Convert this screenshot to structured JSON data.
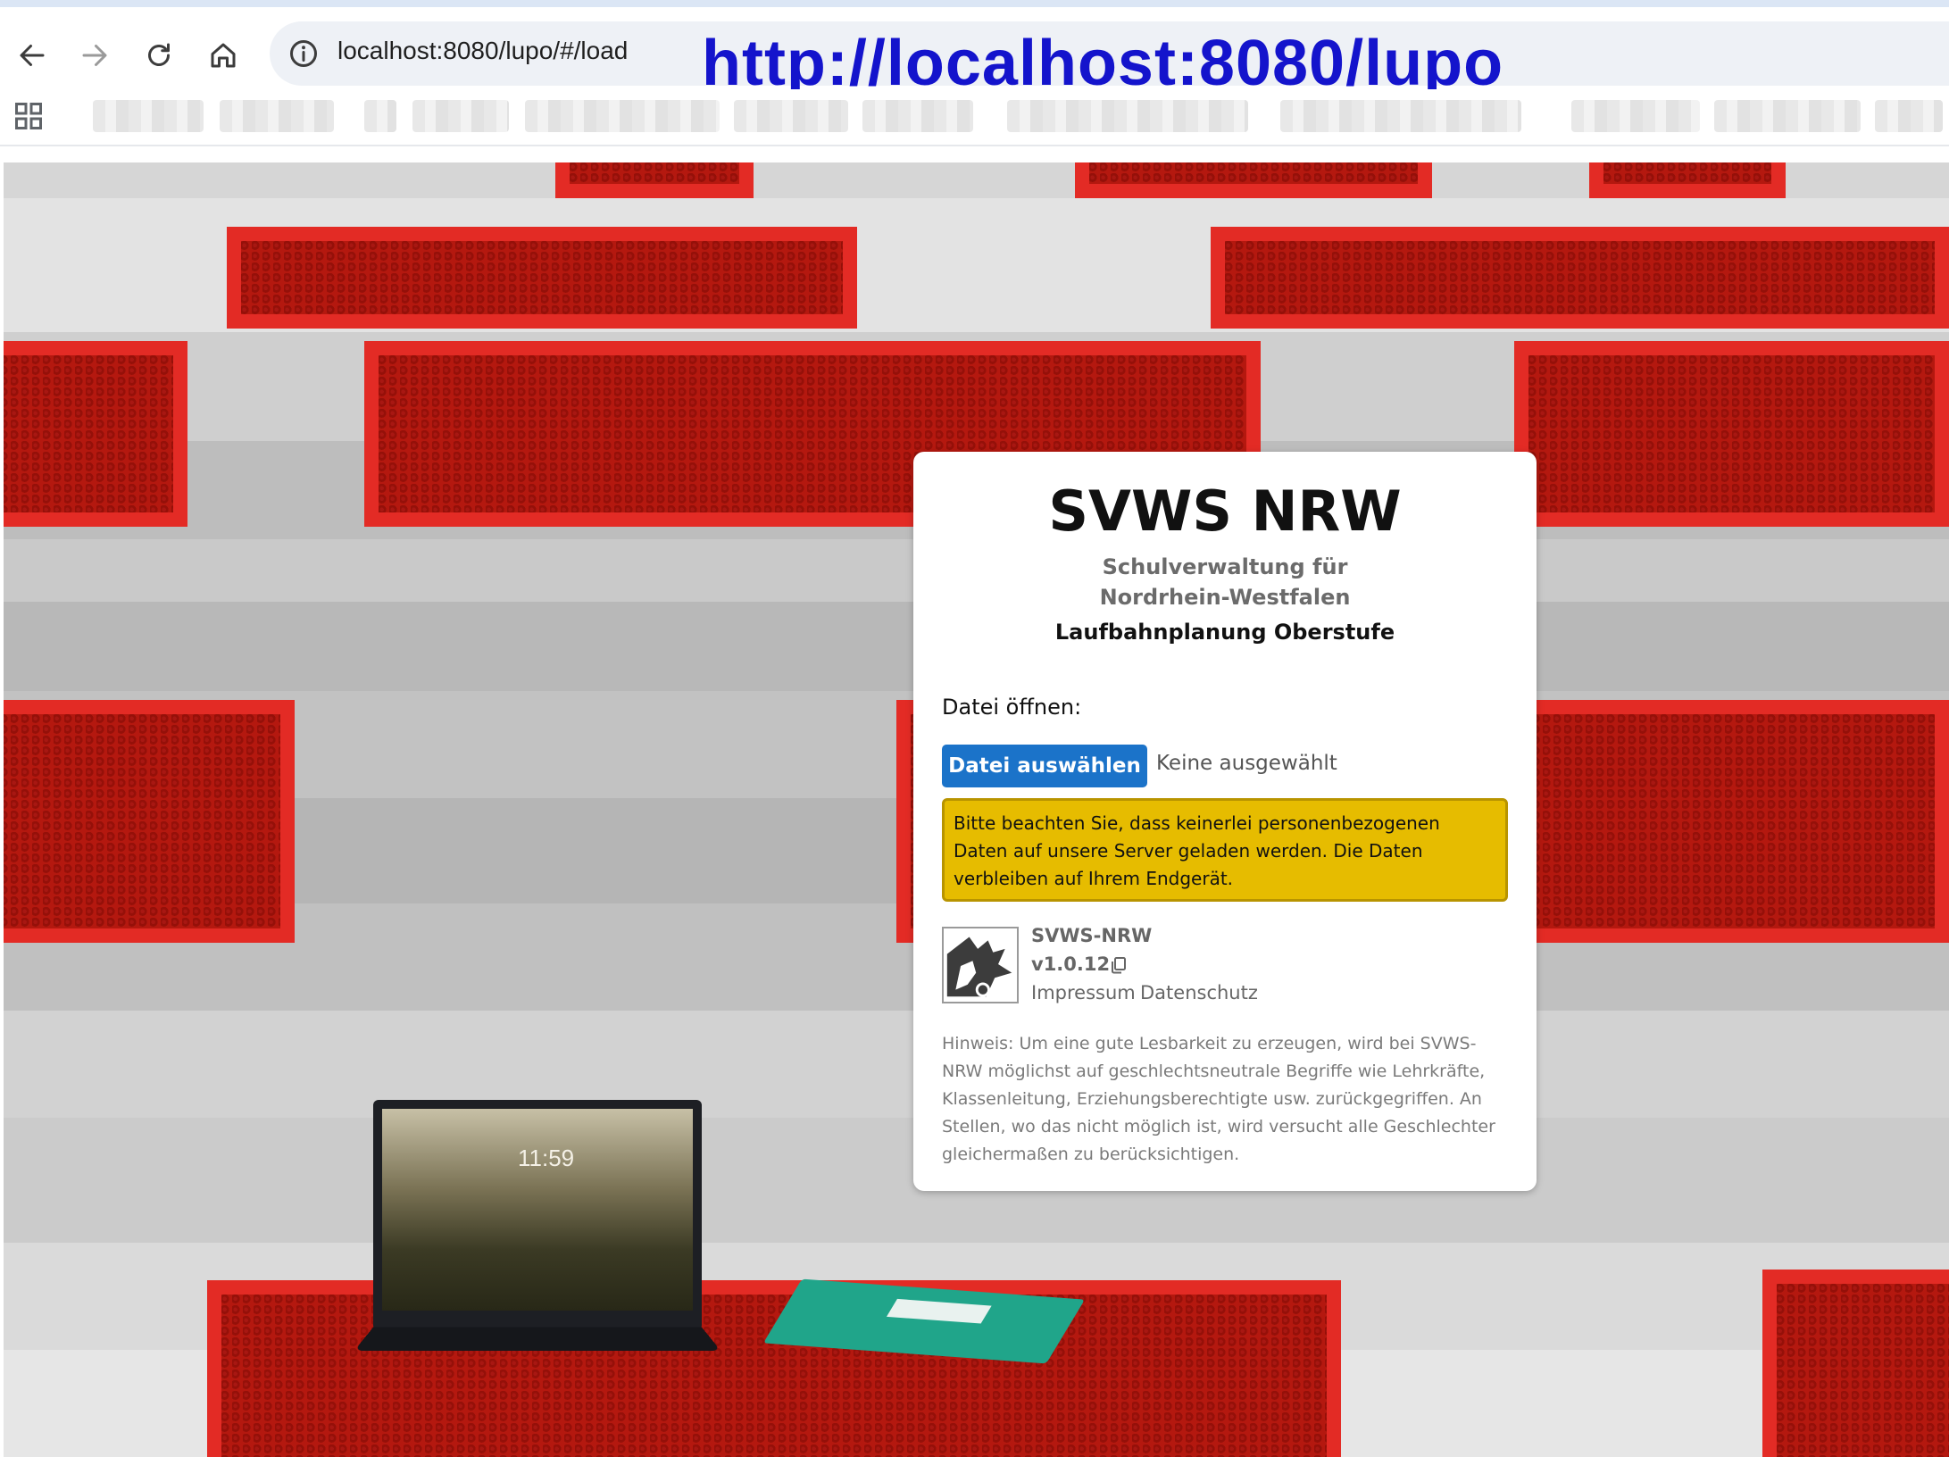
{
  "browser": {
    "url": "localhost:8080/lupo/#/load",
    "url_overlay": "http://localhost:8080/lupo",
    "icons": {
      "back": "arrow-left-icon",
      "forward": "arrow-right-icon",
      "reload": "reload-icon",
      "home": "home-icon",
      "site_info": "info-icon",
      "apps": "apps-grid-icon"
    }
  },
  "card": {
    "title": "SVWS NRW",
    "subtitle_line1": "Schulverwaltung für",
    "subtitle_line2": "Nordrhein-Westfalen",
    "app_name": "Laufbahnplanung Oberstufe",
    "file_label": "Datei öffnen:",
    "file_button": "Datei auswählen",
    "file_none": "Keine ausgewählt",
    "notice": "Bitte beachten Sie, dass keinerlei personenbezogenen Daten auf unsere Server geladen werden. Die Daten verbleiben auf Ihrem Endgerät.",
    "brand_name": "SVWS-NRW",
    "version": "v1.0.12",
    "link_impressum": "Impressum",
    "link_datenschutz": "Datenschutz",
    "hint": "Hinweis: Um eine gute Lesbarkeit zu erzeugen, wird bei SVWS-NRW möglichst auf geschlechtsneutrale Begriffe wie Lehrkräfte, Klassenleitung, Erziehungsberechtigte usw. zurückgegriffen. An Stellen, wo das nicht möglich ist, wird versucht alle Geschlechter gleichermaßen zu berücksichtigen."
  },
  "background": {
    "clock": "11:59"
  },
  "colors": {
    "button": "#1b73c9",
    "notice_bg": "#e6bc00",
    "url_overlay": "#1414cc",
    "bench_red": "#e32b25"
  }
}
